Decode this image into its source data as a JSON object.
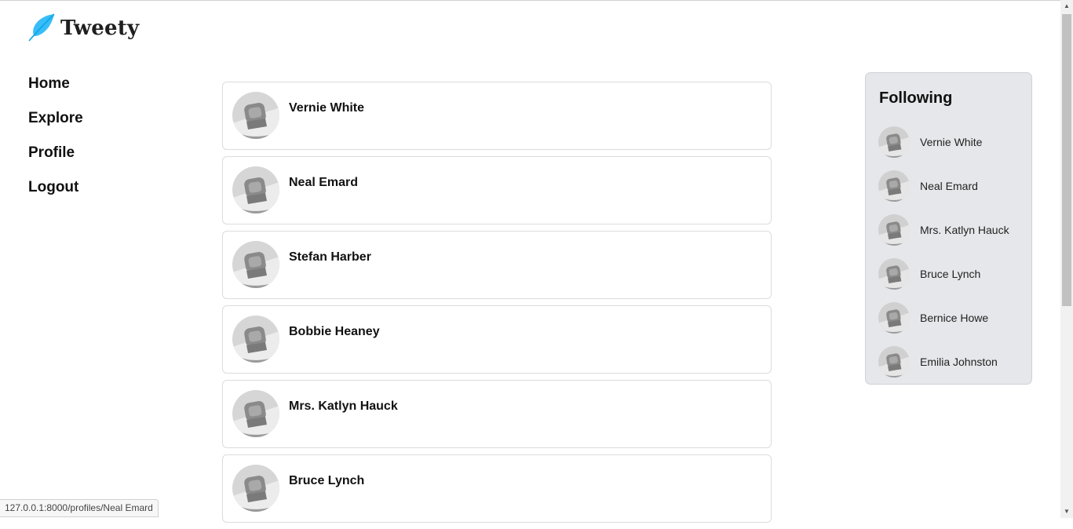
{
  "brand": {
    "name": "Tweety",
    "icon": "feather-icon",
    "color": "#38bdf8"
  },
  "nav": {
    "items": [
      {
        "label": "Home"
      },
      {
        "label": "Explore"
      },
      {
        "label": "Profile"
      },
      {
        "label": "Logout"
      }
    ]
  },
  "feed": {
    "profiles": [
      {
        "name": "Vernie White"
      },
      {
        "name": "Neal Emard"
      },
      {
        "name": "Stefan Harber"
      },
      {
        "name": "Bobbie Heaney"
      },
      {
        "name": "Mrs. Katlyn Hauck"
      },
      {
        "name": "Bruce Lynch"
      }
    ]
  },
  "sidebar": {
    "title": "Following",
    "items": [
      {
        "name": "Vernie White"
      },
      {
        "name": "Neal Emard"
      },
      {
        "name": "Mrs. Katlyn Hauck"
      },
      {
        "name": "Bruce Lynch"
      },
      {
        "name": "Bernice Howe"
      },
      {
        "name": "Emilia Johnston"
      }
    ]
  },
  "status_bar": {
    "url": "127.0.0.1:8000/profiles/Neal Emard"
  }
}
